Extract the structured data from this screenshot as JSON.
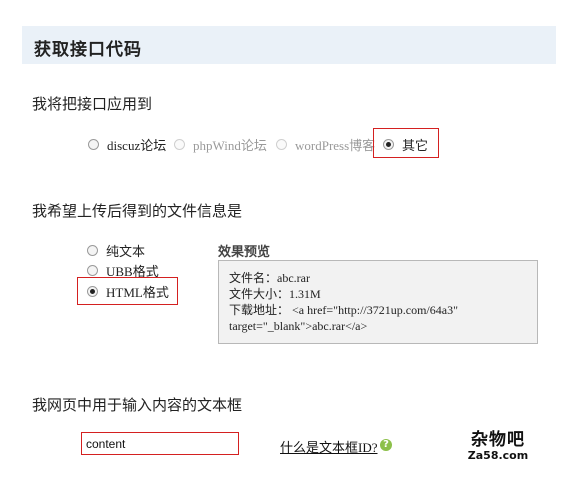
{
  "header": {
    "title": "获取接口代码"
  },
  "apply_to": {
    "label": "我将把接口应用到",
    "options": [
      {
        "label": "discuz论坛",
        "selected": false,
        "disabled": false
      },
      {
        "label": "phpWind论坛",
        "selected": false,
        "disabled": true
      },
      {
        "label": "wordPress博客",
        "selected": false,
        "disabled": true
      },
      {
        "label": "其它",
        "selected": true,
        "disabled": false
      }
    ]
  },
  "file_info": {
    "label": "我希望上传后得到的文件信息是",
    "options": [
      {
        "label": "纯文本",
        "selected": false
      },
      {
        "label": "UBB格式",
        "selected": false
      },
      {
        "label": "HTML格式",
        "selected": true
      }
    ],
    "preview": {
      "title": "效果预览",
      "lines": [
        "文件名：abc.rar",
        "文件大小：1.31M",
        "下载地址：  <a href=\"http://3721up.com/64a3\"",
        "target=\"_blank\">abc.rar</a>"
      ]
    }
  },
  "textbox": {
    "label": "我网页中用于输入内容的文本框",
    "value": "content",
    "help_link": "什么是文本框ID?",
    "help_icon": "question-icon"
  },
  "logo": {
    "line1": "杂物吧",
    "line2": "Za58.com"
  },
  "colors": {
    "highlight_border": "#d42020",
    "header_bg": "#eaf1f8",
    "help_icon_bg": "#8cc04a"
  }
}
